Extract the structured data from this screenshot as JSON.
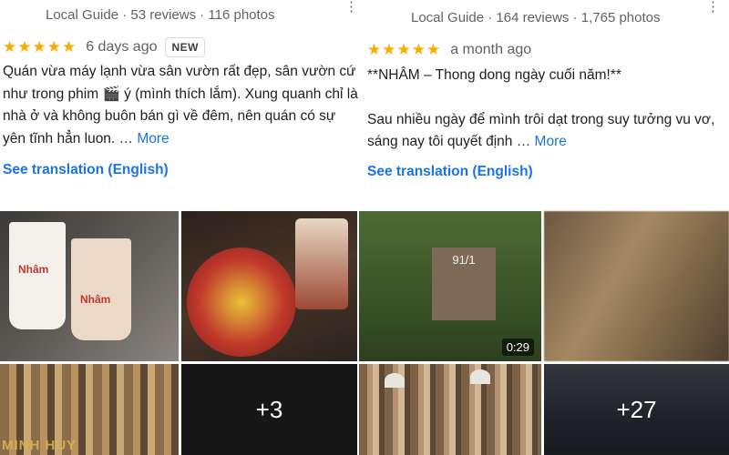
{
  "reviews": [
    {
      "meta": "Local Guide · 53 reviews · 116 photos",
      "stars": "★★★★★",
      "rating": 5,
      "date": "6 days ago",
      "badge": "NEW",
      "text": "Quán vừa máy lạnh vừa sân vườn rất đẹp, sân vườn cứ như trong phim 🎬 ý (mình thích lắm). Xung quanh chỉ là nhà ở và không buôn bán gì về đêm, nên quán có sự yên tĩnh hẳn luon. …",
      "more_label": "More",
      "translate_label": "See translation (English)",
      "menu_icon": "more-vert-icon"
    },
    {
      "meta": "Local Guide · 164 reviews · 1,765 photos",
      "stars": "★★★★★",
      "rating": 5,
      "date": "a month ago",
      "text_line1": "**NHÂM – Thong dong ngày cuối năm!**",
      "text_line2": "Sau nhiều ngày để mình trôi dạt trong suy tưởng vu vơ, sáng nay tôi quyết định …",
      "more_label": "More",
      "translate_label": "See translation (English)",
      "menu_icon": "more-vert-icon"
    }
  ],
  "photos": {
    "cup_label_1": "Nhâm",
    "cup_label_2": "Nhâm",
    "sign_text": "91/1",
    "video_duration": "0:29",
    "more_count_1": "+3",
    "more_count_2": "+27",
    "watermark": "MINH HUY"
  },
  "colors": {
    "star": "#f9ab00",
    "link": "#1a73e8",
    "meta": "#5f6368"
  }
}
